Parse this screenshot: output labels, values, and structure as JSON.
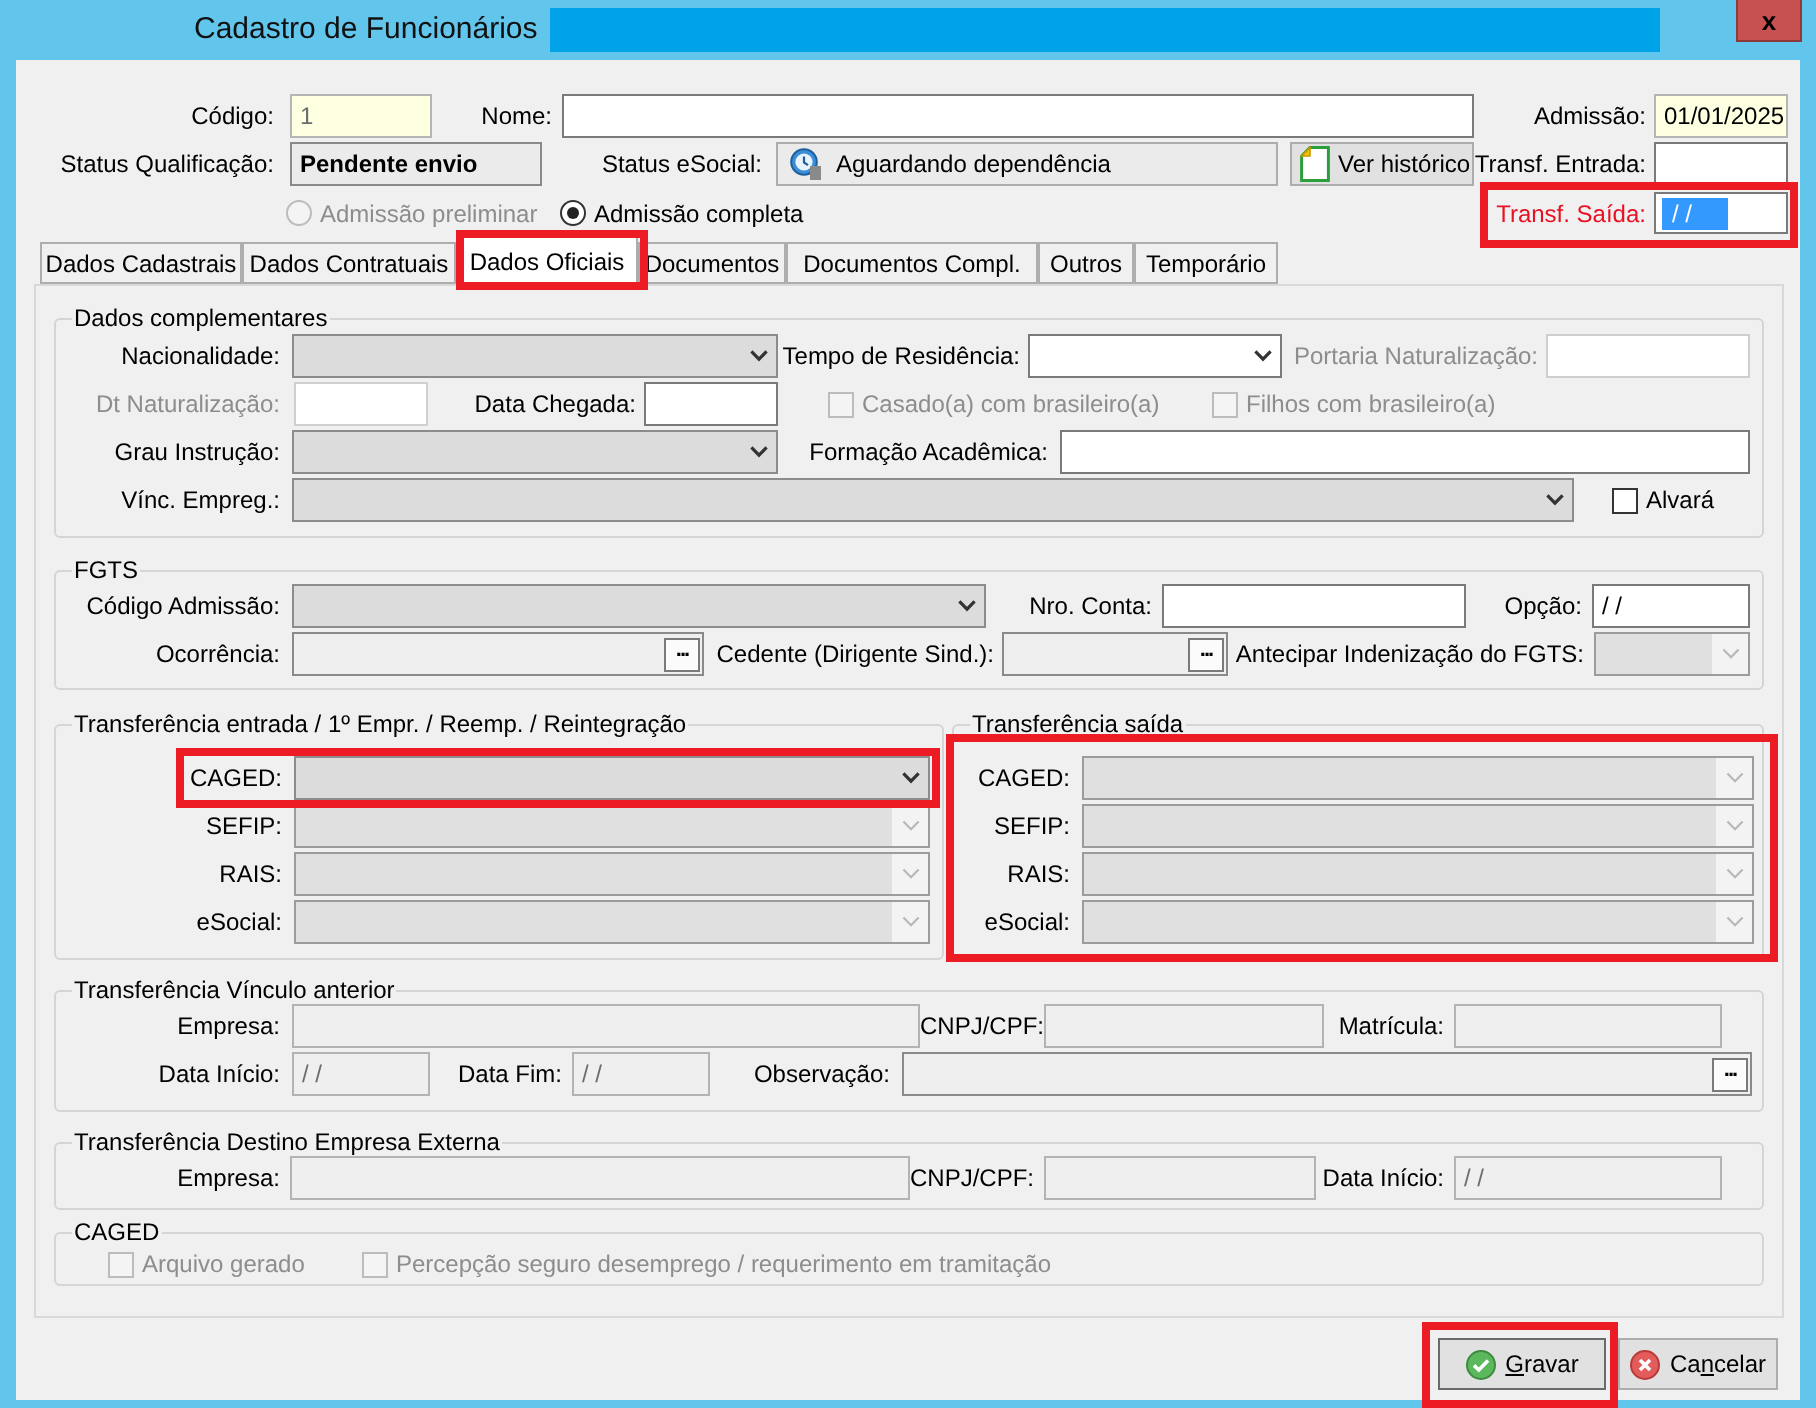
{
  "window": {
    "title": "Cadastro de Funcionários",
    "close_label": "x"
  },
  "header": {
    "codigo": {
      "label": "Código:",
      "value": "1",
      "mandatory": true,
      "disabled": true
    },
    "nome": {
      "label": "Nome:"
    },
    "admissao": {
      "label": "Admissão:",
      "value": "01/01/2025",
      "mandatory": true
    },
    "status_qualificacao": {
      "label": "Status Qualificação:",
      "value": "Pendente envio"
    },
    "status_esocial": {
      "label": "Status eSocial:",
      "value": "Aguardando dependência"
    },
    "history_button": {
      "label": "Ver histórico"
    },
    "transf_entrada": {
      "label": "Transf. Entrada:"
    },
    "admission_type": [
      {
        "label": "Admissão preliminar",
        "selected": false,
        "disabled": true
      },
      {
        "label": "Admissão completa",
        "selected": true,
        "disabled": false
      }
    ],
    "transf_saida": {
      "label": "Transf. Saída:",
      "value": "/ /",
      "warning": true,
      "text_selected": true,
      "highlighted": true
    }
  },
  "tabs": [
    {
      "label": "Dados Cadastrais",
      "selected": false,
      "highlighted": false
    },
    {
      "label": "Dados Contratuais",
      "selected": false,
      "highlighted": false
    },
    {
      "label": "Dados Oficiais",
      "selected": true,
      "highlighted": true
    },
    {
      "label": "Documentos",
      "selected": false,
      "highlighted": false
    },
    {
      "label": "Documentos Compl.",
      "selected": false,
      "highlighted": false
    },
    {
      "label": "Outros",
      "selected": false,
      "highlighted": false
    },
    {
      "label": "Temporário",
      "selected": false,
      "highlighted": false
    }
  ],
  "groups": [
    {
      "title": "Dados complementares",
      "highlighted": false,
      "fields": [
        {
          "kind": "combo",
          "label": "Nacionalidade:",
          "editable": false,
          "disabled": false
        },
        {
          "kind": "combo",
          "label": "Tempo de Residência:",
          "editable": true,
          "disabled": false
        },
        {
          "kind": "text",
          "label": "Portaria Naturalização:",
          "disabled": true
        },
        {
          "kind": "text",
          "label": "Dt Naturalização:",
          "disabled": true
        },
        {
          "kind": "text",
          "label": "Data Chegada:",
          "disabled": false
        },
        {
          "kind": "check",
          "label": "Casado(a) com brasileiro(a)",
          "checked": false,
          "disabled": true
        },
        {
          "kind": "check",
          "label": "Filhos com brasileiro(a)",
          "checked": false,
          "disabled": true
        },
        {
          "kind": "combo",
          "label": "Grau Instrução:",
          "editable": false,
          "disabled": false
        },
        {
          "kind": "text",
          "label": "Formação Acadêmica:",
          "disabled": false
        },
        {
          "kind": "combo",
          "label": "Vínc. Empreg.:",
          "editable": false,
          "disabled": false
        },
        {
          "kind": "check",
          "label": "Alvará",
          "checked": false,
          "disabled": false
        }
      ]
    },
    {
      "title": "FGTS",
      "highlighted": false,
      "fields": [
        {
          "kind": "combo",
          "label": "Código Admissão:",
          "editable": false,
          "disabled": false
        },
        {
          "kind": "text",
          "label": "Nro. Conta:",
          "disabled": false
        },
        {
          "kind": "text",
          "label": "Opção:",
          "value": "/ /",
          "disabled": false
        },
        {
          "kind": "lookup",
          "label": "Ocorrência:",
          "button_label": "..."
        },
        {
          "kind": "lookup",
          "label": "Cedente (Dirigente Sind.):",
          "button_label": "..."
        },
        {
          "kind": "combo",
          "label": "Antecipar Indenização do FGTS:",
          "editable": false,
          "disabled": true
        }
      ]
    },
    {
      "title": "Transferência entrada / 1º Empr. / Reemp. / Reintegração",
      "highlighted": false,
      "fields": [
        {
          "kind": "combo",
          "label": "CAGED:",
          "editable": false,
          "disabled": false,
          "highlighted": true
        },
        {
          "kind": "combo",
          "label": "SEFIP:",
          "editable": false,
          "disabled": true,
          "highlighted": false
        },
        {
          "kind": "combo",
          "label": "RAIS:",
          "editable": false,
          "disabled": true,
          "highlighted": false
        },
        {
          "kind": "combo",
          "label": "eSocial:",
          "editable": false,
          "disabled": true,
          "highlighted": false
        }
      ]
    },
    {
      "title": "Transferência saída",
      "highlighted": true,
      "fields": [
        {
          "kind": "combo",
          "label": "CAGED:",
          "editable": false,
          "disabled": true,
          "highlighted": false
        },
        {
          "kind": "combo",
          "label": "SEFIP:",
          "editable": false,
          "disabled": true,
          "highlighted": false
        },
        {
          "kind": "combo",
          "label": "RAIS:",
          "editable": false,
          "disabled": true,
          "highlighted": false
        },
        {
          "kind": "combo",
          "label": "eSocial:",
          "editable": false,
          "disabled": true,
          "highlighted": false
        }
      ]
    },
    {
      "title": "Transferência Vínculo anterior",
      "highlighted": false,
      "fields": [
        {
          "kind": "text",
          "label": "Empresa:",
          "read_only": true
        },
        {
          "kind": "text",
          "label": "CNPJ/CPF:",
          "read_only": true
        },
        {
          "kind": "text",
          "label": "Matrícula:",
          "read_only": true
        },
        {
          "kind": "text",
          "label": "Data Início:",
          "value": "/ /",
          "read_only": true
        },
        {
          "kind": "text",
          "label": "Data Fim:",
          "value": "/ /",
          "read_only": true
        },
        {
          "kind": "lookup",
          "label": "Observação:",
          "button_label": "..."
        }
      ]
    },
    {
      "title": "Transferência Destino Empresa Externa",
      "highlighted": false,
      "fields": [
        {
          "kind": "text",
          "label": "Empresa:",
          "read_only": true
        },
        {
          "kind": "text",
          "label": "CNPJ/CPF:",
          "read_only": true
        },
        {
          "kind": "text",
          "label": "Data Início:",
          "value": "/ /",
          "read_only": true
        }
      ]
    },
    {
      "title": "CAGED",
      "highlighted": false,
      "fields": [
        {
          "kind": "check",
          "label": "Arquivo gerado",
          "checked": false,
          "disabled": true
        },
        {
          "kind": "check",
          "label": "Percepção seguro desemprego / requerimento em tramitação",
          "checked": false,
          "disabled": true
        }
      ]
    }
  ],
  "buttons": [
    {
      "kind": "save",
      "access_key": "G",
      "label_end": "ravar",
      "highlighted": true
    },
    {
      "kind": "cancel",
      "label_start": "Ca",
      "access_key": "n",
      "label_end": "celar",
      "highlighted": false
    }
  ]
}
